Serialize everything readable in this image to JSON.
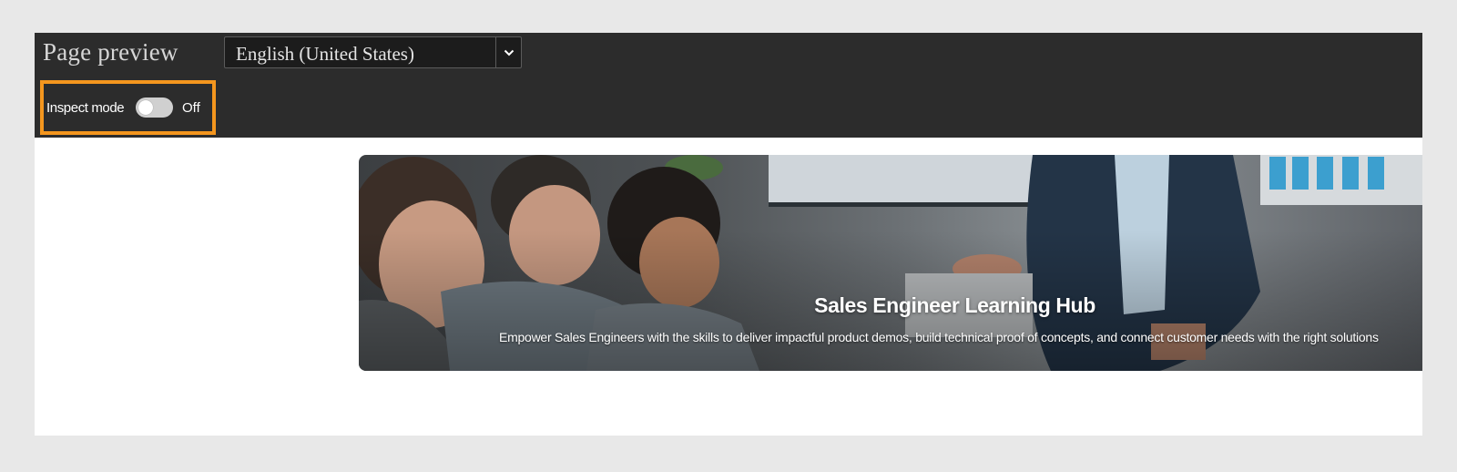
{
  "header": {
    "title": "Page preview",
    "language_select": {
      "value": "English (United States)",
      "arrow_icon": "chevron-down-icon"
    }
  },
  "inspect": {
    "label": "Inspect mode",
    "state": "Off",
    "enabled": false,
    "highlight_color": "#f4961e"
  },
  "banner": {
    "title": "Sales Engineer Learning Hub",
    "subtitle": "Empower Sales Engineers with the skills to deliver impactful product demos, build technical proof of concepts, and connect customer needs with the right solutions"
  }
}
